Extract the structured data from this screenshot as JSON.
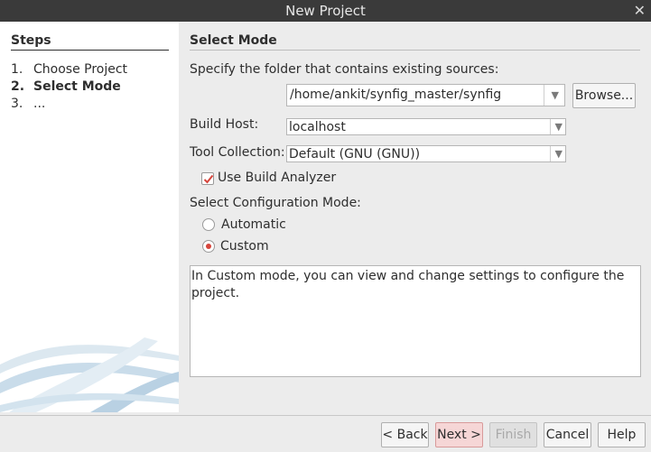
{
  "window": {
    "title": "New Project",
    "close_glyph": "✕"
  },
  "steps": {
    "heading": "Steps",
    "items": [
      {
        "num": "1.",
        "label": "Choose Project",
        "active": false
      },
      {
        "num": "2.",
        "label": "Select Mode",
        "active": true
      },
      {
        "num": "3.",
        "label": "...",
        "active": false
      }
    ]
  },
  "main": {
    "heading": "Select Mode",
    "folder_label": "Specify the folder that contains existing sources:",
    "folder_value": "/home/ankit/synfig_master/synfig",
    "browse_label": "Browse...",
    "build_host_label": "Build Host:",
    "build_host_value": "localhost",
    "tool_collection_label": "Tool Collection:",
    "tool_collection_value": "Default (GNU (GNU))",
    "use_build_analyzer_label": "Use Build Analyzer",
    "use_build_analyzer_checked": true,
    "config_mode_label": "Select Configuration Mode:",
    "modes": [
      {
        "label": "Automatic",
        "selected": false
      },
      {
        "label": "Custom",
        "selected": true
      }
    ],
    "description": "In Custom mode, you can view and change settings to configure the project."
  },
  "footer": {
    "back_label": "< Back",
    "next_label": "Next >",
    "finish_label": "Finish",
    "cancel_label": "Cancel",
    "help_label": "Help"
  },
  "colors": {
    "accent": "#d6453c",
    "titlebar": "#3a3a3a",
    "primary_button": "#f6d6d6"
  }
}
